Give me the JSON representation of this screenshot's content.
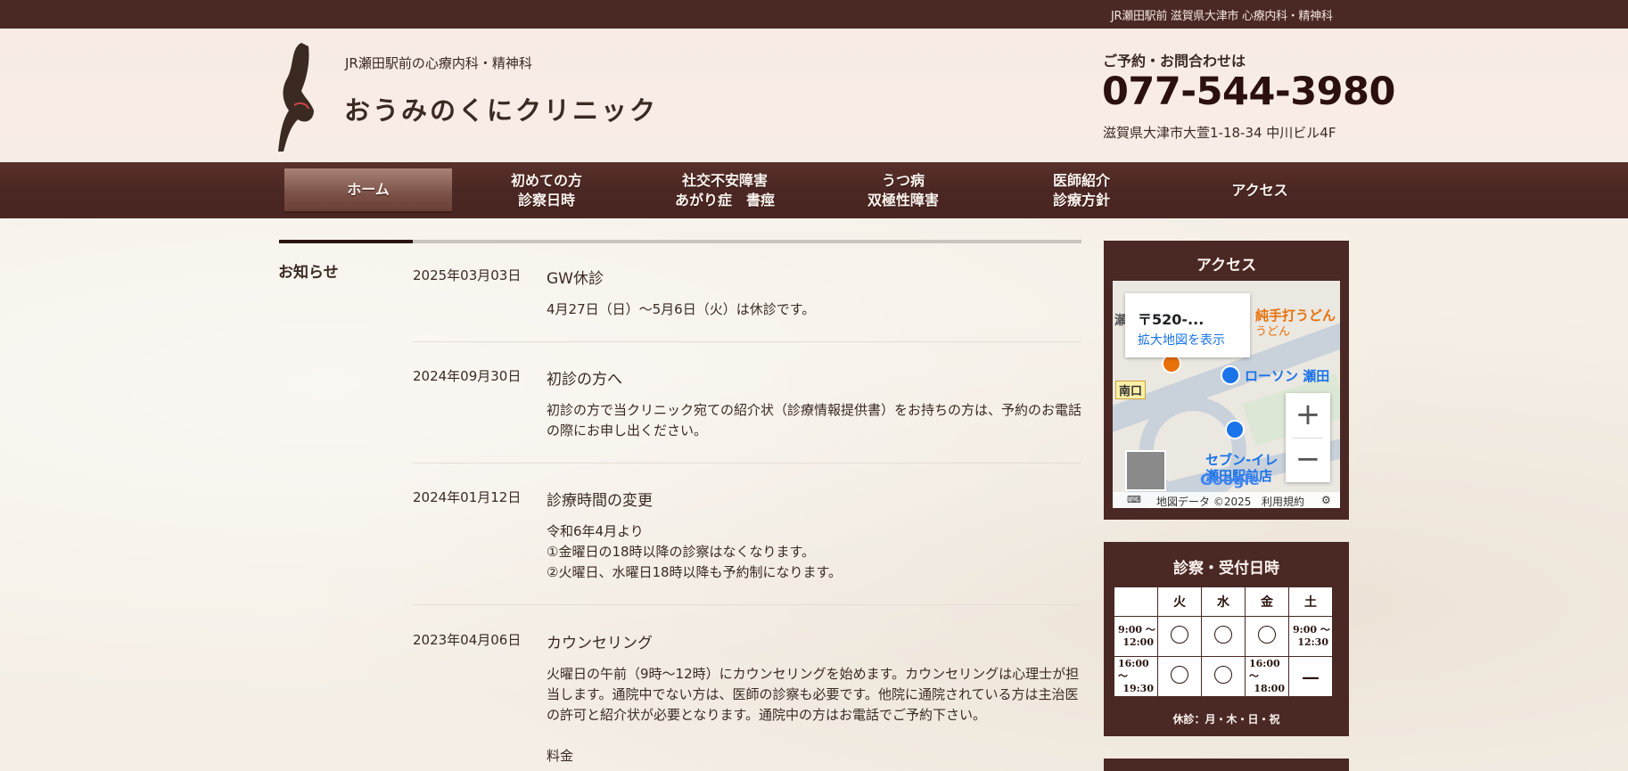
{
  "topbar": {
    "text": "JR瀬田駅前 滋賀県大津市 心療内科・精神科"
  },
  "header": {
    "tagline": "JR瀬田駅前の心療内科・精神科",
    "clinic_name": "おうみのくにクリニック",
    "contact_label": "ご予約・お問合わせは",
    "phone": "077-544-3980",
    "address": "滋賀県大津市大萱1-18-34 中川ビル4F"
  },
  "nav": [
    {
      "line1": "ホーム",
      "line2": ""
    },
    {
      "line1": "初めての方",
      "line2": "診察日時"
    },
    {
      "line1": "社交不安障害",
      "line2": "あがり症　書痙"
    },
    {
      "line1": "うつ病",
      "line2": "双極性障害"
    },
    {
      "line1": "医師紹介",
      "line2": "診療方針"
    },
    {
      "line1": "アクセス",
      "line2": ""
    }
  ],
  "news": {
    "title": "お知らせ",
    "items": [
      {
        "date": "2025年03月03日",
        "title": "GW休診",
        "body": "4月27日（日）～5月6日（火）は休診です。"
      },
      {
        "date": "2024年09月30日",
        "title": "初診の方へ",
        "body": "初診の方で当クリニック宛ての紹介状（診療情報提供書）をお持ちの方は、予約のお電話の際にお申し出ください。"
      },
      {
        "date": "2024年01月12日",
        "title": "診療時間の変更",
        "body": "令和6年4月より\n①金曜日の18時以降の診察はなくなります。\n②火曜日、水曜日18時以降も予約制になります。"
      },
      {
        "date": "2023年04月06日",
        "title": "カウンセリング",
        "body": "火曜日の午前（9時～12時）にカウンセリングを始めます。カウンセリングは心理士が担当します。通院中でない方は、医師の診察も必要です。他院に通院されている方は主治医の許可と紹介状が必要となります。通院中の方はお電話でご予約下さい。\n\n料金"
      }
    ]
  },
  "access": {
    "title": "アクセス",
    "map": {
      "popup_zip": "〒520-...",
      "popup_link": "拡大地図を表示",
      "label_udon": "純手打うどん",
      "label_udon2": "うどん",
      "label_lawson": "ローソン 瀬田",
      "label_seven1": "セブン-イレ",
      "label_seven2": "瀬田駅前店",
      "label_south_exit": "南口",
      "label_seta": "瀬",
      "zoom_in": "+",
      "zoom_out": "−",
      "footer_data": "地図データ ©2025",
      "footer_terms": "利用規約",
      "google": "Google"
    }
  },
  "hours": {
    "title": "診察・受付日時",
    "days": [
      "",
      "火",
      "水",
      "金",
      "土"
    ],
    "rows": [
      {
        "time_start": "9:00 〜",
        "time_end": "12:00",
        "cells": [
          "○",
          "○",
          "○",
          ""
        ],
        "sat_start": "9:00 〜",
        "sat_end": "12:30"
      },
      {
        "time_start": "16:00 〜",
        "time_end": "19:30",
        "cells": [
          "○",
          "○",
          "",
          "—"
        ],
        "fri_start": "16:00 〜",
        "fri_end": "18:00"
      }
    ],
    "closed": "休診：月・木・日・祝"
  }
}
